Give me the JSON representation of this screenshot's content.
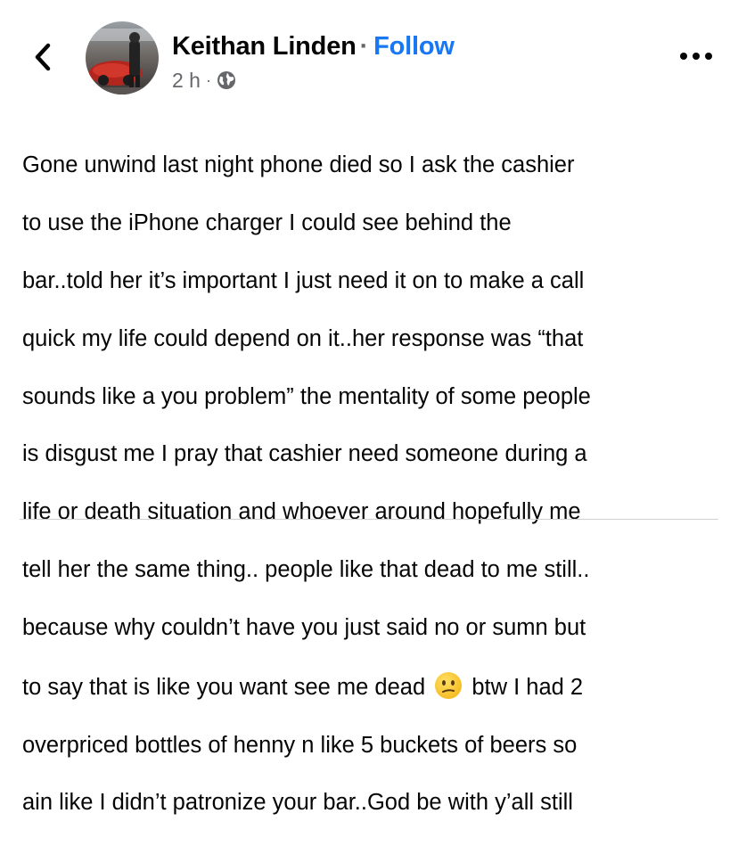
{
  "header": {
    "author_name": "Keithan Linden",
    "separator": "·",
    "follow_label": "Follow",
    "timestamp": "2 h",
    "meta_separator": "·",
    "privacy_icon": "globe-icon",
    "back_icon": "chevron-left-icon",
    "more_icon": "ellipsis-icon"
  },
  "post": {
    "lines": [
      "Gone unwind last night phone died so I ask the cashier",
      "to use the iPhone charger I could see behind the",
      "bar..told her it’s important I just need it on to make a call",
      "quick my life could depend on it..her response was “that",
      "sounds like a you problem” the mentality of some people",
      "is disgust me I pray that cashier need someone during a",
      "life or death situation and whoever around hopefully me",
      "tell her the same thing.. people like that dead to me still..",
      "because why couldn’t have you just said no or sumn but"
    ],
    "line10_before_emoji": "to say that is like you want see me dead",
    "emoji": "confused-face-emoji",
    "line10_after_emoji": "btw I had 2",
    "lines_end": [
      "overpriced bottles of henny n like 5 buckets of beers so",
      "ain like I didn’t patronize your bar..God be with y’all still"
    ]
  },
  "colors": {
    "link": "#1877f2",
    "secondary_text": "#65676b",
    "primary_text": "#050505",
    "divider": "#ced0d4"
  }
}
